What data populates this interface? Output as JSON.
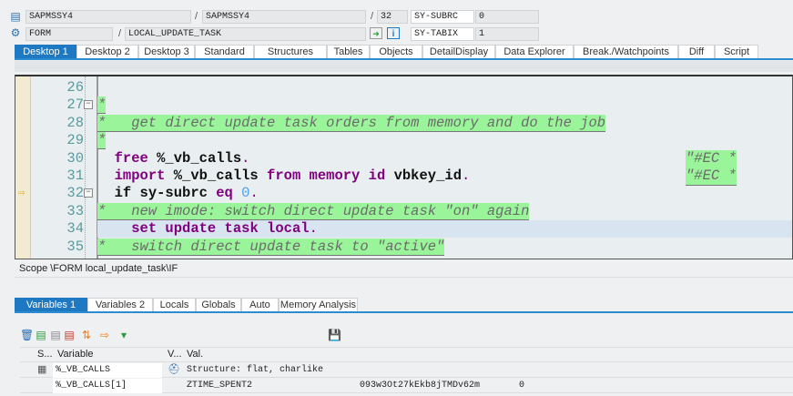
{
  "header": {
    "program": "SAPMSSY4",
    "include": "SAPMSSY4",
    "line": "32",
    "sysfield1_name": "SY-SUBRC",
    "sysfield1_value": "0",
    "event_type": "FORM",
    "event_name": "LOCAL_UPDATE_TASK",
    "sysfield2_name": "SY-TABIX",
    "sysfield2_value": "1",
    "slash": "/"
  },
  "desktop_tabs": [
    "Desktop 1",
    "Desktop 2",
    "Desktop 3",
    "Standard",
    "Structures",
    "Tables",
    "Objects",
    "DetailDisplay",
    "Data Explorer",
    "Break./Watchpoints",
    "Diff",
    "Script"
  ],
  "code_lines": [
    {
      "n": "26",
      "tokens": []
    },
    {
      "n": "27",
      "fold": "-",
      "tokens": [
        {
          "t": "*",
          "c": "cmt"
        }
      ]
    },
    {
      "n": "28",
      "tokens": [
        {
          "t": "*   get direct update task orders from memory and do the job",
          "c": "cmt"
        }
      ]
    },
    {
      "n": "29",
      "tokens": [
        {
          "t": "*",
          "c": "cmt"
        }
      ]
    },
    {
      "n": "30",
      "tokens": [
        {
          "t": "  ",
          "c": ""
        },
        {
          "t": "free",
          "c": "kw"
        },
        {
          "t": " %_vb_calls",
          "c": "id"
        },
        {
          "t": ".",
          "c": "pun"
        }
      ],
      "tail": "\"#EC *"
    },
    {
      "n": "31",
      "tokens": [
        {
          "t": "  ",
          "c": ""
        },
        {
          "t": "import",
          "c": "kw"
        },
        {
          "t": " %_vb_calls ",
          "c": "id"
        },
        {
          "t": "from memory id",
          "c": "kw"
        },
        {
          "t": " vbkey_id",
          "c": "id"
        },
        {
          "t": ".",
          "c": "pun"
        }
      ],
      "tail": "\"#EC *"
    },
    {
      "n": "32",
      "fold": "-",
      "current": true,
      "tokens": [
        {
          "t": "  ",
          "c": ""
        },
        {
          "t": "if",
          "c": "id"
        },
        {
          "t": " sy-subrc ",
          "c": "id"
        },
        {
          "t": "eq",
          "c": "kw"
        },
        {
          "t": " ",
          "c": ""
        },
        {
          "t": "0",
          "c": "num"
        },
        {
          "t": ".",
          "c": "pun"
        }
      ]
    },
    {
      "n": "33",
      "tokens": [
        {
          "t": "*   new imode: switch direct update task \"on\" again",
          "c": "cmt"
        }
      ]
    },
    {
      "n": "34",
      "highlight": true,
      "tokens": [
        {
          "t": "    ",
          "c": ""
        },
        {
          "t": "set update task local",
          "c": "kw"
        },
        {
          "t": ".",
          "c": "pun"
        }
      ]
    },
    {
      "n": "35",
      "tokens": [
        {
          "t": "*   switch direct update task to \"active\"",
          "c": "cmt"
        }
      ]
    }
  ],
  "scope": "Scope \\FORM local_update_task\\IF",
  "var_tabs": [
    "Variables 1",
    "Variables 2",
    "Locals",
    "Globals",
    "Auto",
    "Memory Analysis"
  ],
  "grid": {
    "headers": {
      "s": "S...",
      "variable": "Variable",
      "v": "V...",
      "val": "Val."
    },
    "rows": [
      {
        "variable": "%_VB_CALLS",
        "val": "Structure: flat, charlike",
        "col2": "",
        "col3": ""
      },
      {
        "variable": "%_VB_CALLS[1]",
        "val": "ZTIME_SPENT2",
        "col2": "093w3Ot27kEkb8jTMDv62m",
        "col3": "0"
      }
    ]
  }
}
